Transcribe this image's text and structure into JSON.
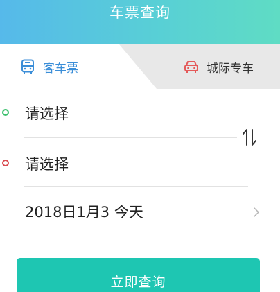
{
  "header": {
    "title": "车票查询"
  },
  "tabs": [
    {
      "label": "客车票",
      "icon": "bus-icon",
      "active": true,
      "color": "#3b8ed8"
    },
    {
      "label": "城际专车",
      "icon": "car-icon",
      "active": false,
      "color": "#e45a5a"
    }
  ],
  "route": {
    "from_placeholder": "请选择",
    "to_placeholder": "请选择",
    "swap_icon": "swap-arrows-icon"
  },
  "date": {
    "value": "2018日1月3  今天"
  },
  "actions": {
    "query_label": "立即查询"
  },
  "colors": {
    "header_gradient_start": "#56b9ea",
    "header_gradient_end": "#5fdcc4",
    "start_dot": "#3bbf6c",
    "end_dot": "#d94b50",
    "primary_button": "#1ec6b2"
  }
}
